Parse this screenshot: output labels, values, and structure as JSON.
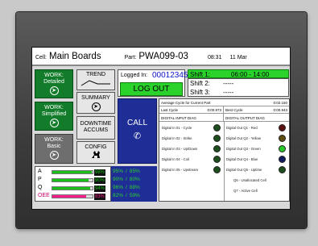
{
  "header": {
    "cell_label": "Cell:",
    "cell_value": "Main Boards",
    "part_label": "Part:",
    "part_value": "PWA099-03",
    "time": "08:31",
    "date": "11 Mar"
  },
  "work_buttons": [
    {
      "label1": "WORK:",
      "label2": "Detailed",
      "active": true
    },
    {
      "label1": "WORK:",
      "label2": "Simplified",
      "active": true
    },
    {
      "label1": "WORK:",
      "label2": "Basic",
      "active": false
    }
  ],
  "nav": {
    "trend": "TREND",
    "summary": "SUMMARY",
    "downtime_line1": "DOWNTIME",
    "downtime_line2": "ACCUMS",
    "config": "CONFIG",
    "call": "CALL"
  },
  "login": {
    "label": "Logged In:",
    "user": "00012345",
    "logout": "LOG OUT"
  },
  "shifts": [
    {
      "label": "Shift 1:",
      "value": "06:00 - 14:00",
      "active": true
    },
    {
      "label": "Shift 2:",
      "value": "-----",
      "active": false
    },
    {
      "label": "Shift 3:",
      "value": "-----",
      "active": false
    }
  ],
  "cycle": {
    "avg_label": "Average Cycle for Current Part",
    "avg_value": "0:02.150",
    "last_label": "Last Cycle",
    "last_value": "0:00.973",
    "best_label": "Best Cycle",
    "best_value": "0:00.943"
  },
  "diag": {
    "input_title": "DIGITAL INPUT DIAG",
    "output_title": "DIGITAL OUTPUT DIAG",
    "inputs": [
      {
        "label": "Digital In 01 - Cycle",
        "color": "#1e4d1e"
      },
      {
        "label": "Digital In 02 - Strike",
        "color": "#1e4d1e"
      },
      {
        "label": "Digital In 03 - Up/Down",
        "color": "#1e4d1e"
      },
      {
        "label": "Digital In 04 - Coil",
        "color": "#1e4d1e"
      },
      {
        "label": "Digital In 05 - Upstream",
        "color": "#1e4d1e"
      }
    ],
    "outputs": [
      {
        "label": "Digital Out Q1 - Red",
        "color": "#5a1010"
      },
      {
        "label": "Digital Out Q2 - Yellow",
        "color": "#5e4c10"
      },
      {
        "label": "Digital Out Q3 - Green",
        "color": "#27c727"
      },
      {
        "label": "Digital Out Q4 - Blue",
        "color": "#121a5e"
      },
      {
        "label": "Digital Out Q5 - Uptime",
        "color": "#1e4d1e"
      },
      {
        "label": "Q6 - Unallocated Cell",
        "color": ""
      },
      {
        "label": "Q7 - Active Cell",
        "color": ""
      }
    ]
  },
  "stats": [
    {
      "letter": "A",
      "pct": "98%",
      "fill": 0.98,
      "color": "#18c018",
      "t1": "95%",
      "t2": "85%",
      "letter_color": "#000"
    },
    {
      "letter": "P",
      "pct": "90%",
      "fill": 0.9,
      "color": "#18c018",
      "t1": "90%",
      "t2": "80%",
      "letter_color": "#000"
    },
    {
      "letter": "Q",
      "pct": "94%",
      "fill": 0.94,
      "color": "#18c018",
      "t1": "96%",
      "t2": "88%",
      "letter_color": "#000"
    },
    {
      "letter": "OEE",
      "pct": "83%",
      "fill": 0.83,
      "color": "#ff1e8c",
      "t1": "82%",
      "t2": "59%",
      "letter_color": "#c8006e"
    }
  ],
  "target_sep": "/"
}
